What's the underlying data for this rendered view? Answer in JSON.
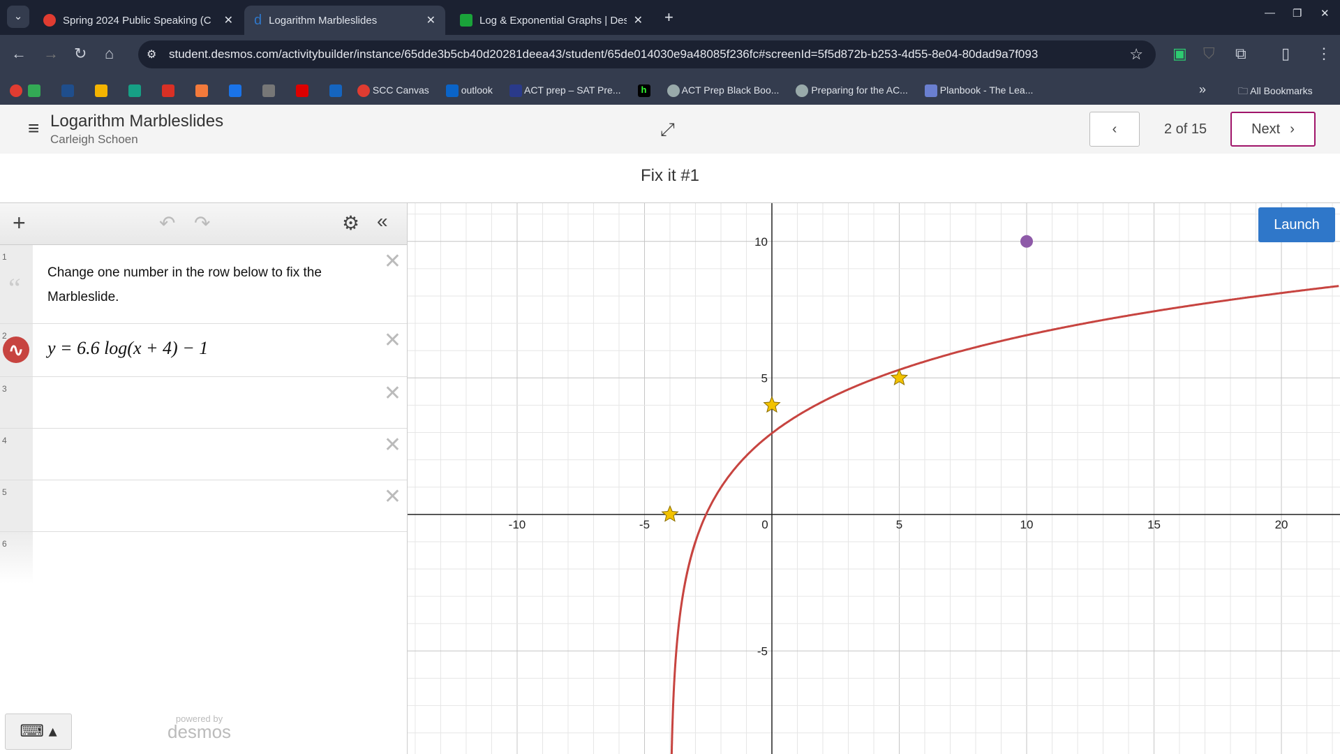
{
  "browser": {
    "tabs": [
      {
        "title": "Spring 2024 Public Speaking (C",
        "icon": "canvas-icon",
        "active": false
      },
      {
        "title": "Logarithm Marbleslides",
        "icon": "desmos-icon",
        "active": true
      },
      {
        "title": "Log & Exponential Graphs | Des",
        "icon": "graph-icon",
        "active": false
      }
    ],
    "url": "student.desmos.com/activitybuilder/instance/65dde3b5cb40d20281deea43/student/65de014030e9a48085f236fc#screenId=5f5d872b-b253-4d55-8e04-80dad9a7f093",
    "bookmarks": [
      {
        "label": "SCC Canvas",
        "color": "#e03c31"
      },
      {
        "label": "outlook",
        "color": "#0a64c8"
      },
      {
        "label": "ACT prep – SAT Pre...",
        "color": "#2a3a8a"
      },
      {
        "label": "",
        "color": "#000"
      },
      {
        "label": "ACT Prep Black Boo...",
        "color": "#9aa"
      },
      {
        "label": "Preparing for the AC...",
        "color": "#9aa"
      },
      {
        "label": "Planbook - The Lea...",
        "color": "#6a7fd0"
      }
    ],
    "all_bookmarks": "All Bookmarks"
  },
  "activity": {
    "title": "Logarithm Marbleslides",
    "student": "Carleigh Schoen",
    "page": "2 of 15",
    "next": "Next",
    "screen_title": "Fix it #1",
    "launch": "Launch"
  },
  "expressions": [
    {
      "num": "1",
      "text": "Change one number in the row below to fix the Marbleslide."
    },
    {
      "num": "2",
      "latex": "y = 6.6 log(x + 4) − 1"
    },
    {
      "num": "3"
    },
    {
      "num": "4"
    },
    {
      "num": "5"
    },
    {
      "num": "6"
    }
  ],
  "powered": "powered by",
  "brand": "desmos",
  "chart_data": {
    "type": "line",
    "function": "y = 6.6 log(x + 4) - 1",
    "curve_color": "#c74440",
    "xlim": [
      -14.3,
      22.3
    ],
    "ylim": [
      -8.8,
      11.4
    ],
    "grid": true,
    "x_ticks": [
      "-10",
      "-5",
      "0",
      "5",
      "10",
      "15",
      "20"
    ],
    "y_ticks": [
      "10",
      "5",
      "-5"
    ],
    "stars": [
      [
        -4,
        0
      ],
      [
        0,
        4
      ],
      [
        5,
        5
      ]
    ],
    "star_color": "#f2c200",
    "marble": [
      10,
      10
    ],
    "marble_color": "#8e5aa8"
  }
}
